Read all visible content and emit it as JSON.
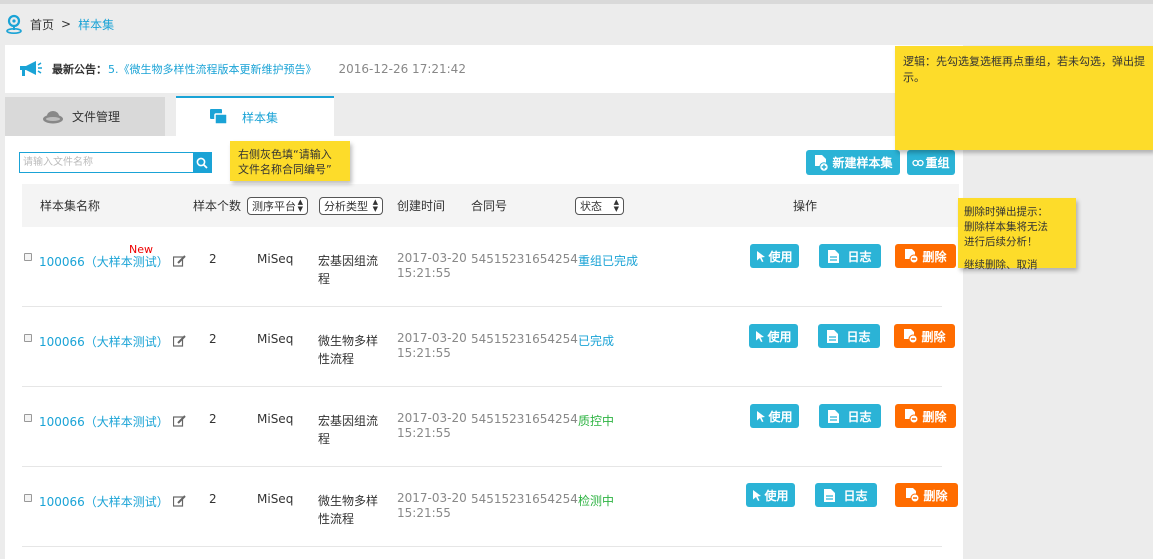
{
  "breadcrumb": {
    "home": "首页",
    "separator": ">",
    "current": "样本集"
  },
  "announcement": {
    "label": "最新公告：",
    "link": "5.《微生物多样性流程版本更新维护预告》",
    "time": "2016-12-26 17:21:42"
  },
  "tabs": [
    {
      "label": "文件管理",
      "icon": "cloud-icon",
      "active": false
    },
    {
      "label": "样本集",
      "icon": "stack-icon",
      "active": true
    }
  ],
  "search": {
    "placeholder": "请输入文件名称",
    "value": ""
  },
  "toolbar": {
    "new_label": "新建样本集",
    "regroup_label": "重组"
  },
  "table": {
    "headers": {
      "name": "样本集名称",
      "count": "样本个数",
      "platform": "测序平台",
      "analysis": "分析类型",
      "created": "创建时间",
      "contract": "合同号",
      "status": "状态",
      "actions": "操作"
    },
    "new_tag": "New",
    "rows": [
      {
        "name": "100066（大样本测试）",
        "count": "2",
        "platform": "MiSeq",
        "analysis_1": "宏基因组流",
        "analysis_2": "程",
        "date": "2017-03-20",
        "time": "15:21:55",
        "contract": "54515231654254",
        "status": "重组已完成",
        "status_kind": "blue"
      },
      {
        "name": "100066（大样本测试）",
        "count": "2",
        "platform": "MiSeq",
        "analysis_1": "微生物多样",
        "analysis_2": "性流程",
        "date": "2017-03-20",
        "time": "15:21:55",
        "contract": "54515231654254",
        "status": "已完成",
        "status_kind": "blue"
      },
      {
        "name": "100066（大样本测试）",
        "count": "2",
        "platform": "MiSeq",
        "analysis_1": "宏基因组流",
        "analysis_2": "程",
        "date": "2017-03-20",
        "time": "15:21:55",
        "contract": "54515231654254",
        "status": "质控中",
        "status_kind": "green"
      },
      {
        "name": "100066（大样本测试）",
        "count": "2",
        "platform": "MiSeq",
        "analysis_1": "微生物多样",
        "analysis_2": "性流程",
        "date": "2017-03-20",
        "time": "15:21:55",
        "contract": "54515231654254",
        "status": "检测中",
        "status_kind": "green"
      }
    ],
    "actions": {
      "use": "使用",
      "log": "日志",
      "delete": "删除"
    }
  },
  "notes": {
    "logic": "逻辑：先勾选复选框再点重组，若未勾选，弹出提示。",
    "search_line1": "右侧灰色填“请输入",
    "search_line2": "文件名称合同编号”",
    "delete_line1": "删除时弹出提示：",
    "delete_line2": "删除样本集将无法",
    "delete_line3": "进行后续分析！",
    "delete_line4": "继续删除、取消"
  },
  "colors": {
    "accent": "#1aa3d6",
    "delete": "#ff6c00",
    "note": "#fddc2a",
    "status_green": "#2db342"
  }
}
